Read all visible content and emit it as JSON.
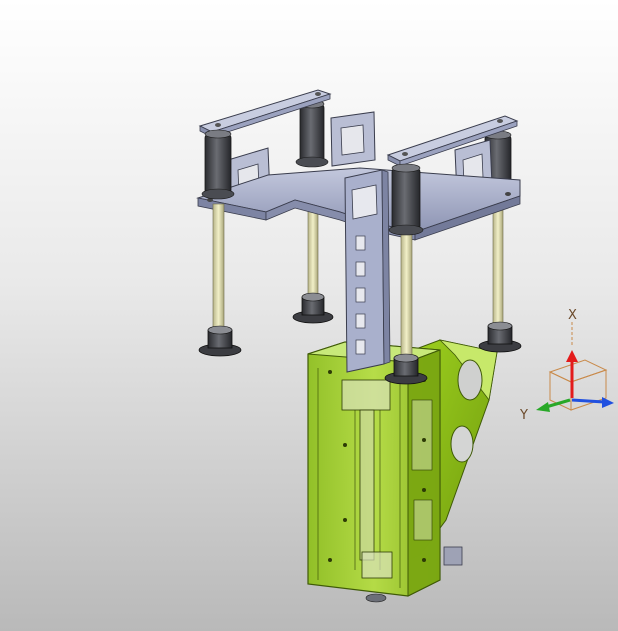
{
  "viewport": {
    "background_top": "#ffffff",
    "background_bottom": "#b9b9b9"
  },
  "model": {
    "frame_color": "#a9b0cc",
    "frame_edge": "#3a3d4d",
    "housing_color": "#9ccc23",
    "housing_edge": "#3f5a07",
    "rod_color": "#e9e7b4",
    "damper_color": "#3d3f44"
  },
  "triad": {
    "x_label": "X",
    "y_label": "Y",
    "x_axis_color": "#e31b1b",
    "y_axis_color": "#28a828",
    "z_axis_color": "#2050e0",
    "box_color": "#c98a4a"
  }
}
